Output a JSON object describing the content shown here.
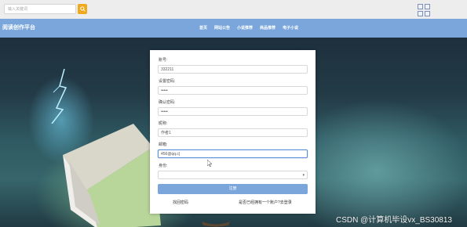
{
  "search": {
    "placeholder": "输入关键词"
  },
  "nav": {
    "brand": "阅读创作平台",
    "items": [
      "首页",
      "网站公告",
      "小说推荐",
      "商品推荐",
      "电子小说"
    ]
  },
  "form": {
    "fields": [
      {
        "label": "账号:",
        "value": "332211"
      },
      {
        "label": "设置密码:",
        "value": "•••••"
      },
      {
        "label": "确认密码:",
        "value": "•••••"
      },
      {
        "label": "昵称:",
        "value": "作者1"
      },
      {
        "label": "邮箱:",
        "value": "456@qq.c|"
      },
      {
        "label": "身份:",
        "value": ""
      }
    ],
    "submit_label": "注册",
    "forgot_link": "找回密码",
    "login_link": "是否已经拥有一个账户?去登录"
  },
  "watermark": "CSDN @计算机毕设vx_BS30813"
}
